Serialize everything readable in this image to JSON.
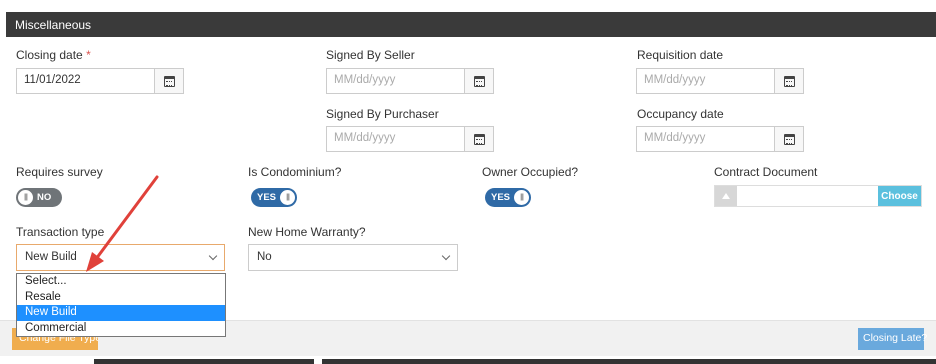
{
  "panel": {
    "title": "Miscellaneous"
  },
  "fields": {
    "closing_date": {
      "label": "Closing date",
      "required_mark": "*",
      "value": "11/01/2022"
    },
    "signed_by_seller": {
      "label": "Signed By Seller",
      "placeholder": "MM/dd/yyyy"
    },
    "requisition_date": {
      "label": "Requisition date",
      "placeholder": "MM/dd/yyyy"
    },
    "signed_by_purchaser": {
      "label": "Signed By Purchaser",
      "placeholder": "MM/dd/yyyy"
    },
    "occupancy_date": {
      "label": "Occupancy date",
      "placeholder": "MM/dd/yyyy"
    }
  },
  "toggles": {
    "requires_survey": {
      "label": "Requires survey",
      "state": "NO"
    },
    "is_condominium": {
      "label": "Is Condominium?",
      "state": "YES"
    },
    "owner_occupied": {
      "label": "Owner Occupied?",
      "state": "YES"
    }
  },
  "contract_document": {
    "label": "Contract Document",
    "choose_label": "Choose"
  },
  "transaction_type": {
    "label": "Transaction type",
    "selected": "New Build",
    "options": [
      "Select...",
      "Resale",
      "New Build",
      "Commercial"
    ]
  },
  "new_home_warranty": {
    "label": "New Home Warranty?",
    "selected": "No"
  },
  "footer": {
    "change_file_type": "Change File Type",
    "closing_late": "Closing Late?"
  },
  "icons": {
    "calendar": "calendar-icon",
    "toggle_knob": "toggle-knob-icon",
    "upload": "upload-icon",
    "chevron": "chevron-down-icon",
    "annotation_arrow": "red-arrow-icon"
  },
  "colors": {
    "header": "#3a3a3a",
    "toggle_on": "#2f6aa6",
    "toggle_off": "#6f7478",
    "selected_option": "#1e90ff",
    "arrow": "#e0413a",
    "orange_button": "#f0ad4e",
    "blue_button": "#6aa9dd"
  }
}
